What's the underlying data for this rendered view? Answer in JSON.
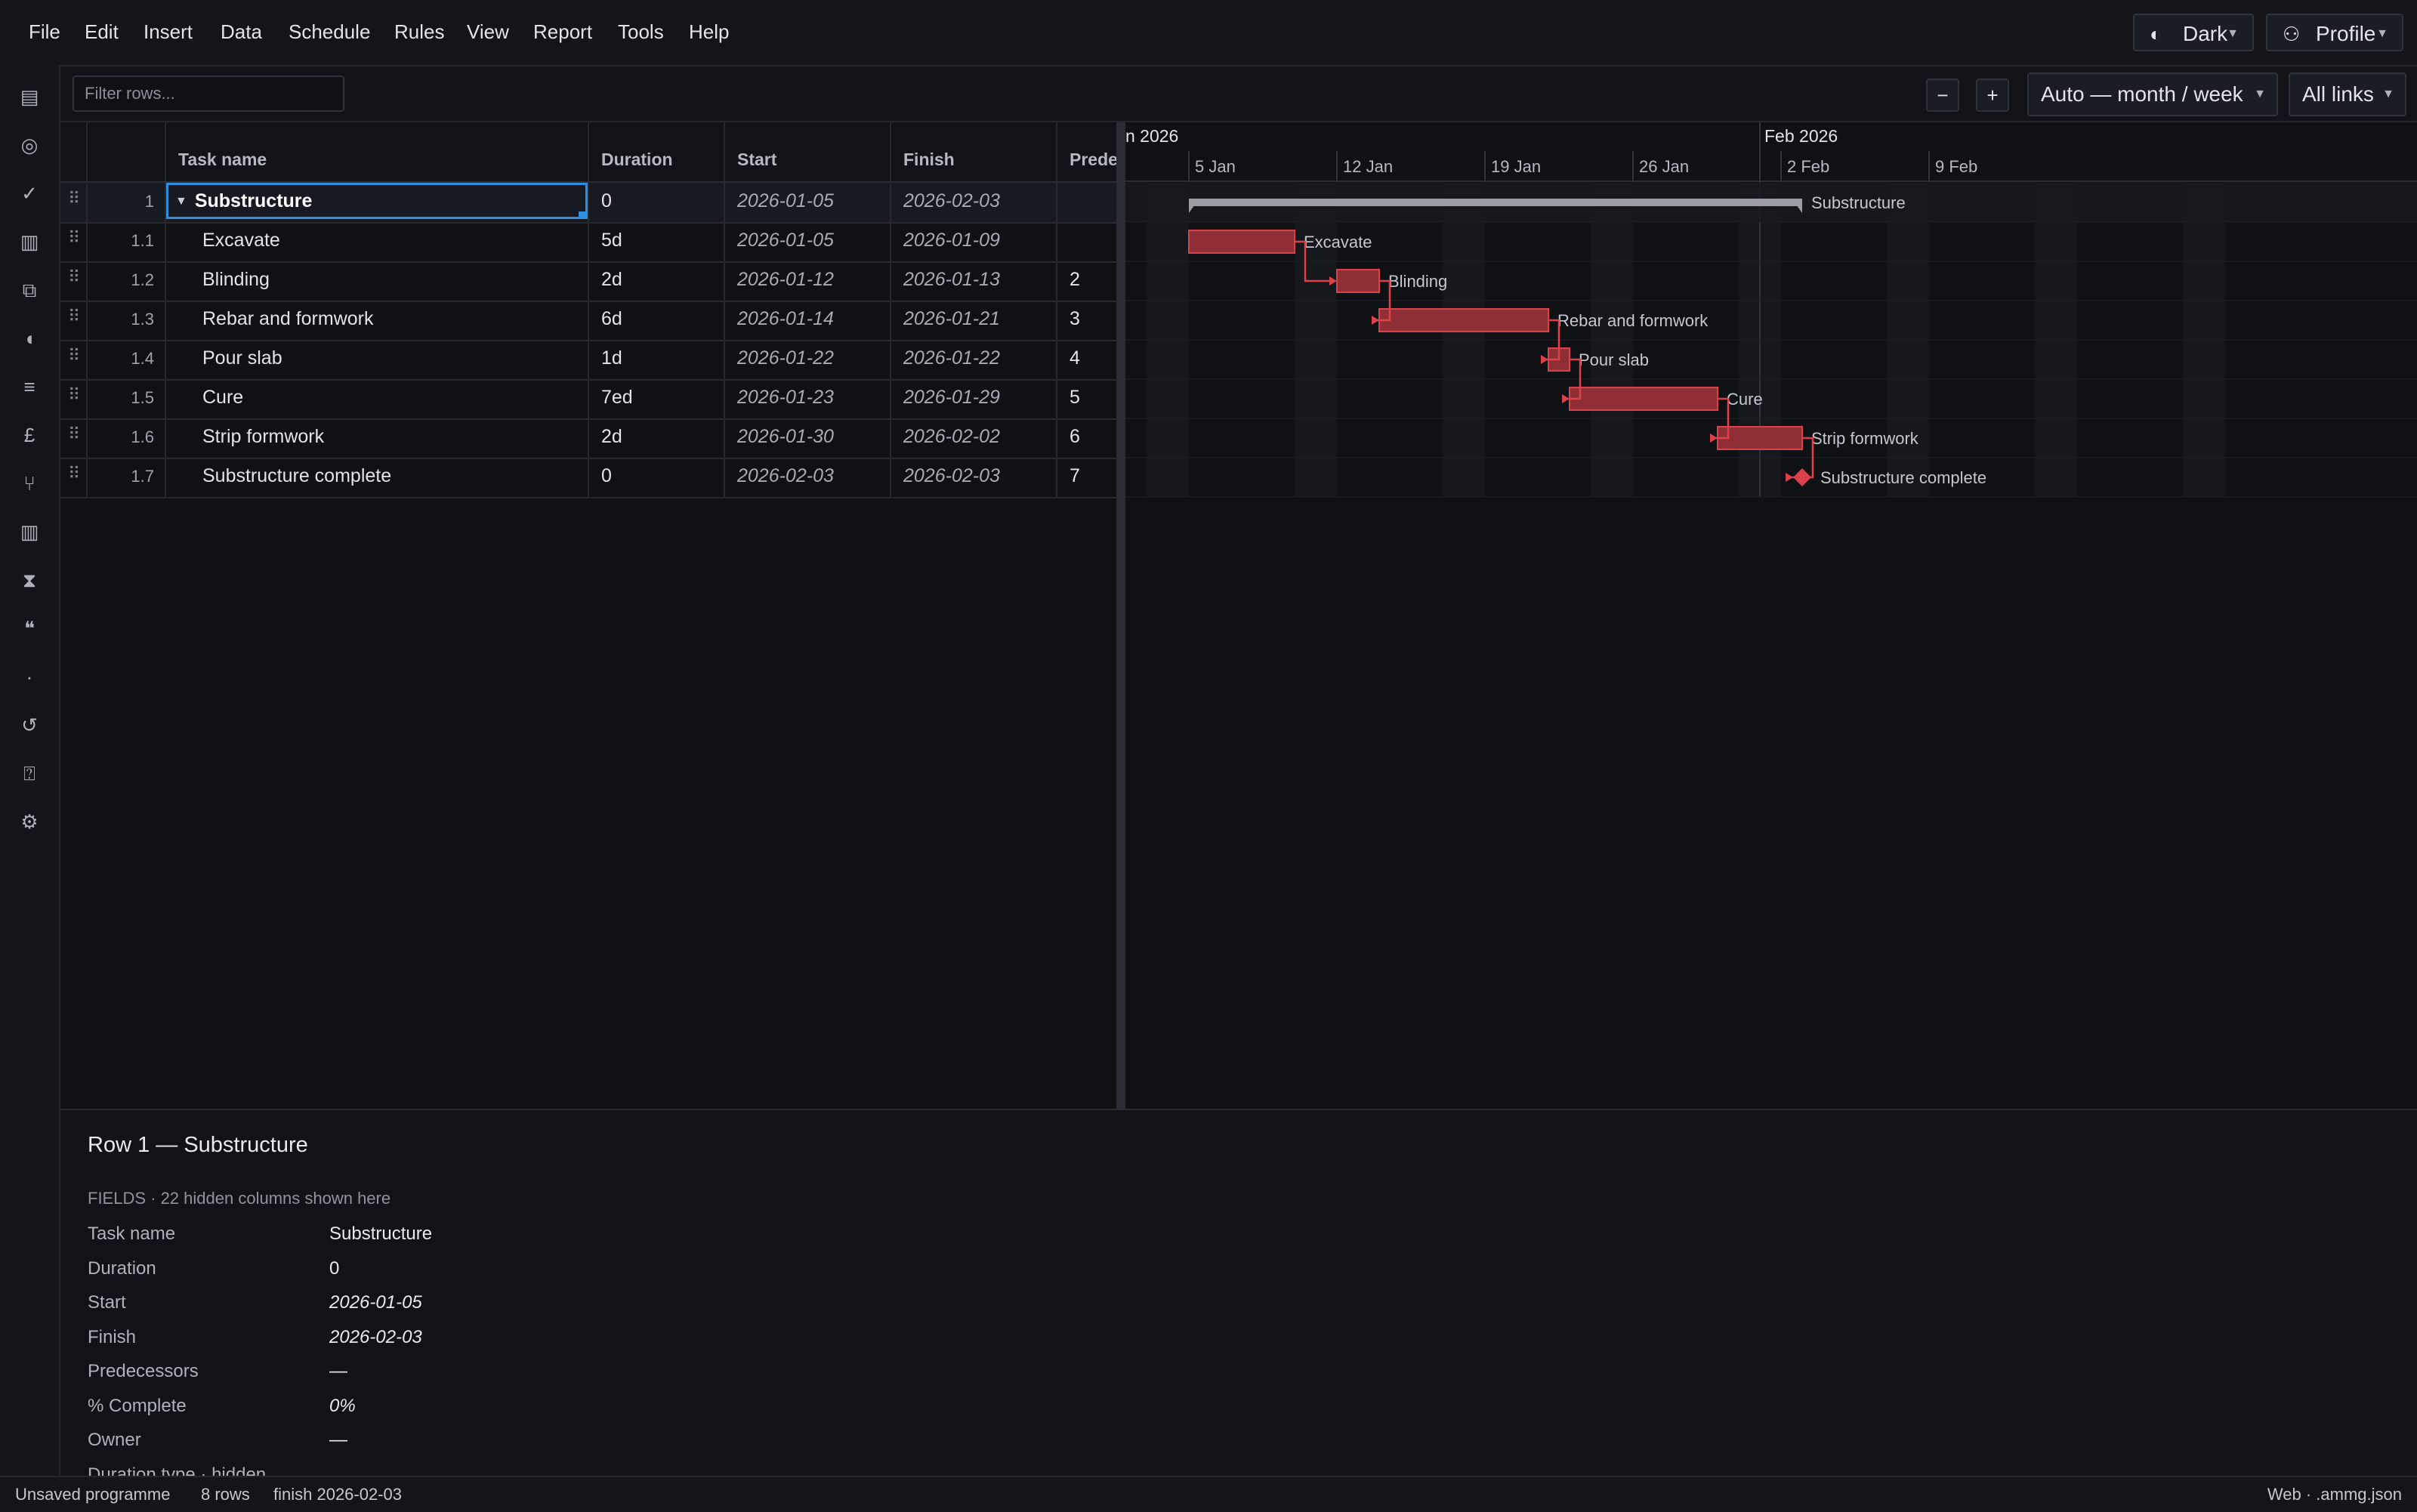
{
  "menu": [
    "File",
    "Edit",
    "Insert",
    "Data",
    "Schedule",
    "Rules",
    "View",
    "Report",
    "Tools",
    "Help"
  ],
  "topright": {
    "theme_label": "Dark",
    "profile_label": "Profile"
  },
  "toolbar": {
    "filter_placeholder": "Filter rows...",
    "zoom_out": "−",
    "zoom_in": "+",
    "timescale": "Auto — month / week",
    "links": "All links"
  },
  "grid": {
    "columns": {
      "task": "Task name",
      "duration": "Duration",
      "start": "Start",
      "finish": "Finish",
      "pred": "Prede"
    },
    "rows": [
      {
        "num": "1",
        "name": "Substructure",
        "duration": "0",
        "start": "2026-01-05",
        "finish": "2026-02-03",
        "pred": "",
        "parent": true
      },
      {
        "num": "1.1",
        "name": "Excavate",
        "duration": "5d",
        "start": "2026-01-05",
        "finish": "2026-01-09",
        "pred": ""
      },
      {
        "num": "1.2",
        "name": "Blinding",
        "duration": "2d",
        "start": "2026-01-12",
        "finish": "2026-01-13",
        "pred": "2"
      },
      {
        "num": "1.3",
        "name": "Rebar and formwork",
        "duration": "6d",
        "start": "2026-01-14",
        "finish": "2026-01-21",
        "pred": "3"
      },
      {
        "num": "1.4",
        "name": "Pour slab",
        "duration": "1d",
        "start": "2026-01-22",
        "finish": "2026-01-22",
        "pred": "4"
      },
      {
        "num": "1.5",
        "name": "Cure",
        "duration": "7ed",
        "start": "2026-01-23",
        "finish": "2026-01-29",
        "pred": "5"
      },
      {
        "num": "1.6",
        "name": "Strip formwork",
        "duration": "2d",
        "start": "2026-01-30",
        "finish": "2026-02-02",
        "pred": "6"
      },
      {
        "num": "1.7",
        "name": "Substructure complete",
        "duration": "0",
        "start": "2026-02-03",
        "finish": "2026-02-03",
        "pred": "7"
      }
    ]
  },
  "gantt": {
    "months": [
      "n 2026",
      "Feb 2026"
    ],
    "weeks": [
      "5 Jan",
      "12 Jan",
      "19 Jan",
      "26 Jan",
      "2 Feb",
      "9 Feb"
    ],
    "bar_color": "#d9424a",
    "summary_color": "#9a9da3",
    "tasks": [
      {
        "label": "Substructure",
        "type": "summary",
        "start": "2026-01-05",
        "finish": "2026-02-03"
      },
      {
        "label": "Excavate",
        "type": "task",
        "start": "2026-01-05",
        "finish": "2026-01-09"
      },
      {
        "label": "Blinding",
        "type": "task",
        "start": "2026-01-12",
        "finish": "2026-01-13"
      },
      {
        "label": "Rebar and formwork",
        "type": "task",
        "start": "2026-01-14",
        "finish": "2026-01-21"
      },
      {
        "label": "Pour slab",
        "type": "task",
        "start": "2026-01-22",
        "finish": "2026-01-22"
      },
      {
        "label": "Cure",
        "type": "task",
        "start": "2026-01-23",
        "finish": "2026-01-29"
      },
      {
        "label": "Strip formwork",
        "type": "task",
        "start": "2026-01-30",
        "finish": "2026-02-02"
      },
      {
        "label": "Substructure complete",
        "type": "milestone",
        "start": "2026-02-03",
        "finish": "2026-02-03"
      }
    ]
  },
  "details": {
    "title": "Row 1 — Substructure",
    "subtitle": "FIELDS · 22 hidden columns shown here",
    "fields": [
      {
        "label": "Task name",
        "value": "Substructure",
        "italic": false
      },
      {
        "label": "Duration",
        "value": "0",
        "italic": false
      },
      {
        "label": "Start",
        "value": "2026-01-05",
        "italic": true
      },
      {
        "label": "Finish",
        "value": "2026-02-03",
        "italic": true
      },
      {
        "label": "Predecessors",
        "value": "—",
        "italic": false
      },
      {
        "label": "% Complete",
        "value": "0%",
        "italic": true
      },
      {
        "label": "Owner",
        "value": "—",
        "italic": false
      },
      {
        "label": "Duration type · hidden",
        "value": "",
        "italic": false
      }
    ]
  },
  "status": {
    "left1": "Unsaved programme",
    "left2": "8 rows",
    "left3": "finish 2026-02-03",
    "right": "Web · .ammg.json"
  }
}
